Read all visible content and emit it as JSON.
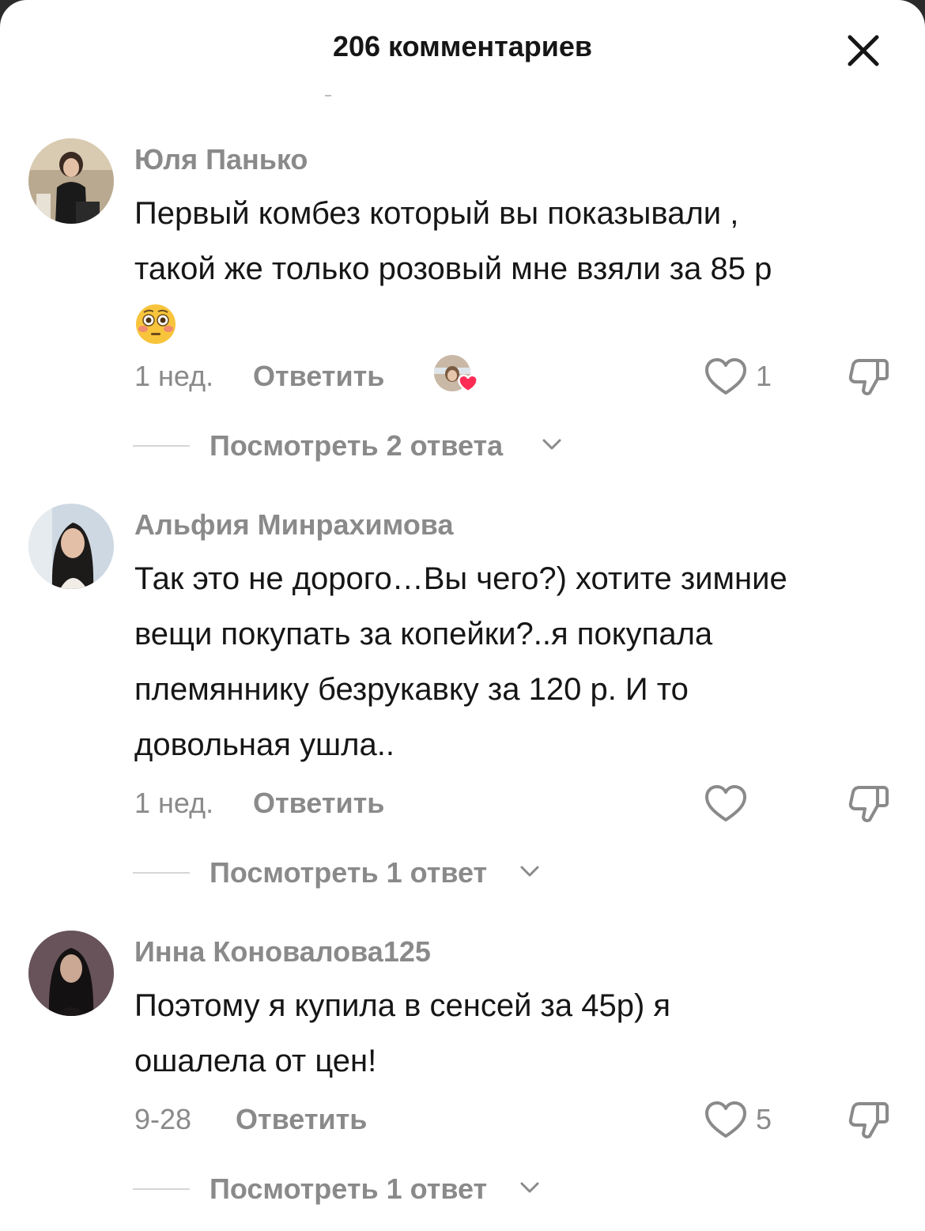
{
  "header": {
    "title": "206 комментариев"
  },
  "comments": [
    {
      "username": "Юля Панько",
      "text_lines": [
        "Первый комбез который вы показывали ,",
        "такой же только розовый мне взяли за 85 р"
      ],
      "emoji": "flushed-face",
      "time": "1 нед.",
      "reply_label": "Ответить",
      "liked_by_creator": true,
      "likes": "1",
      "replies_label": "Посмотреть 2 ответа"
    },
    {
      "username": "Альфия Минрахимова",
      "text_lines": [
        "Так это не дорого…Вы чего?) хотите зимние",
        "вещи покупать за копейки?..я покупала",
        "племяннику безрукавку за 120 р. И то",
        "довольная ушла.."
      ],
      "time": "1 нед.",
      "reply_label": "Ответить",
      "likes": "",
      "replies_label": "Посмотреть 1 ответ"
    },
    {
      "username": "Инна Коновалова125",
      "text_lines": [
        "Поэтому я купила в сенсей за 45р) я",
        "ошалела от цен!"
      ],
      "time": "9-28",
      "reply_label": "Ответить",
      "likes": "5",
      "replies_label": "Посмотреть 1 ответ"
    }
  ],
  "icons": {
    "close": "close-icon",
    "like": "heart-outline-icon",
    "dislike": "thumbs-down-icon",
    "expand": "chevron-down-icon"
  },
  "colors": {
    "text": "#161616",
    "muted": "#8a8a8a",
    "like_heart": "#fe2c55"
  }
}
